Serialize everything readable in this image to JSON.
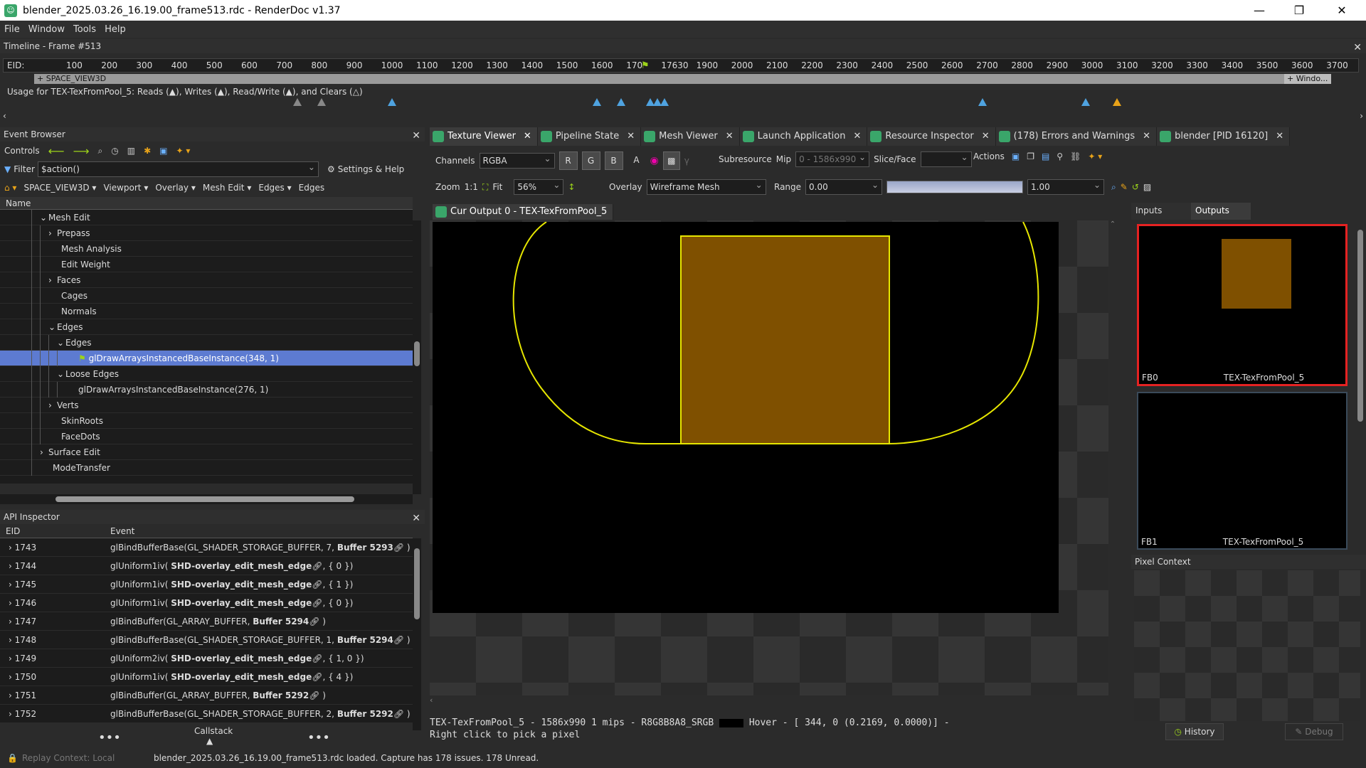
{
  "window": {
    "title": "blender_2025.03.26_16.19.00_frame513.rdc - RenderDoc v1.37"
  },
  "menu": [
    "File",
    "Window",
    "Tools",
    "Help"
  ],
  "timeline": {
    "title": "Timeline - Frame #513",
    "eid_label": "EID:",
    "ticks": [
      "100",
      "200",
      "300",
      "400",
      "500",
      "600",
      "700",
      "800",
      "900",
      "1000",
      "1100",
      "1200",
      "1300",
      "1400",
      "1500",
      "1600",
      "170",
      "17630",
      "1900",
      "2000",
      "2100",
      "2200",
      "2300",
      "2400",
      "2500",
      "2600",
      "2700",
      "2800",
      "2900",
      "3000",
      "3100",
      "3200",
      "3300",
      "3400",
      "3500",
      "3600",
      "3700"
    ],
    "section": "+ SPACE_VIEW3D",
    "section2": "+ Windo...",
    "usage": "Usage for TEX-TexFromPool_5: Reads (▲), Writes (▲), Read/Write (▲), and Clears (△)"
  },
  "event_browser": {
    "title": "Event Browser",
    "controls_label": "Controls",
    "filter_label": "Filter",
    "filter_value": "$action()",
    "settings_label": "Settings & Help",
    "breadcrumbs": [
      "SPACE_VIEW3D",
      "Viewport",
      "Overlay",
      "Mesh Edit",
      "Edges",
      "Edges"
    ],
    "column": "Name",
    "rows": [
      {
        "label": "Mesh Edit",
        "caret": "⌄",
        "indent": 1
      },
      {
        "label": "Prepass",
        "caret": "›",
        "indent": 2
      },
      {
        "label": "Mesh Analysis",
        "caret": "",
        "indent": 2
      },
      {
        "label": "Edit Weight",
        "caret": "",
        "indent": 2
      },
      {
        "label": "Faces",
        "caret": "›",
        "indent": 2
      },
      {
        "label": "Cages",
        "caret": "",
        "indent": 2
      },
      {
        "label": "Normals",
        "caret": "",
        "indent": 2
      },
      {
        "label": "Edges",
        "caret": "⌄",
        "indent": 2
      },
      {
        "label": "Edges",
        "caret": "⌄",
        "indent": 3
      },
      {
        "label": "glDrawArraysInstancedBaseInstance(348, 1)",
        "caret": "",
        "indent": 4,
        "selected": true
      },
      {
        "label": "Loose Edges",
        "caret": "⌄",
        "indent": 3
      },
      {
        "label": "glDrawArraysInstancedBaseInstance(276, 1)",
        "caret": "",
        "indent": 4
      },
      {
        "label": "Verts",
        "caret": "›",
        "indent": 2
      },
      {
        "label": "SkinRoots",
        "caret": "",
        "indent": 2
      },
      {
        "label": "FaceDots",
        "caret": "",
        "indent": 2
      },
      {
        "label": "Surface Edit",
        "caret": "›",
        "indent": 1
      },
      {
        "label": "ModeTransfer",
        "caret": "",
        "indent": 1
      }
    ]
  },
  "api_inspector": {
    "title": "API Inspector",
    "col_eid": "EID",
    "col_event": "Event",
    "rows": [
      {
        "eid": "1743",
        "pre": "glBindBufferBase(GL_SHADER_STORAGE_BUFFER, 7, ",
        "bold": "Buffer 5293",
        "post": " )"
      },
      {
        "eid": "1744",
        "pre": "glUniform1iv( ",
        "bold": "SHD-overlay_edit_mesh_edge",
        "post": ", { 0 })"
      },
      {
        "eid": "1745",
        "pre": "glUniform1iv( ",
        "bold": "SHD-overlay_edit_mesh_edge",
        "post": ", { 1 })"
      },
      {
        "eid": "1746",
        "pre": "glUniform1iv( ",
        "bold": "SHD-overlay_edit_mesh_edge",
        "post": ", { 0 })"
      },
      {
        "eid": "1747",
        "pre": "glBindBuffer(GL_ARRAY_BUFFER, ",
        "bold": "Buffer 5294",
        "post": " )"
      },
      {
        "eid": "1748",
        "pre": "glBindBufferBase(GL_SHADER_STORAGE_BUFFER, 1, ",
        "bold": "Buffer 5294",
        "post": " )"
      },
      {
        "eid": "1749",
        "pre": "glUniform2iv( ",
        "bold": "SHD-overlay_edit_mesh_edge",
        "post": ", { 1, 0 })"
      },
      {
        "eid": "1750",
        "pre": "glUniform1iv( ",
        "bold": "SHD-overlay_edit_mesh_edge",
        "post": ", { 4 })"
      },
      {
        "eid": "1751",
        "pre": "glBindBuffer(GL_ARRAY_BUFFER, ",
        "bold": "Buffer 5292",
        "post": " )"
      },
      {
        "eid": "1752",
        "pre": "glBindBufferBase(GL_SHADER_STORAGE_BUFFER, 2, ",
        "bold": "Buffer 5292",
        "post": " )"
      }
    ],
    "callstack": "Callstack"
  },
  "tabs": [
    {
      "label": "Texture Viewer",
      "active": true
    },
    {
      "label": "Pipeline State"
    },
    {
      "label": "Mesh Viewer"
    },
    {
      "label": "Launch Application"
    },
    {
      "label": "Resource Inspector"
    },
    {
      "label": "(178) Errors and Warnings"
    },
    {
      "label": "blender [PID 16120]"
    }
  ],
  "texture_viewer": {
    "channels_label": "Channels",
    "channels_value": "RGBA",
    "ch_r": "R",
    "ch_g": "G",
    "ch_b": "B",
    "ch_a": "A",
    "subresource_label": "Subresource",
    "mip_label": "Mip",
    "mip_value": "0 - 1586x990",
    "slice_label": "Slice/Face",
    "actions_label": "Actions",
    "zoom_label": "Zoom",
    "zoom_11": "1:1",
    "fit_label": "Fit",
    "zoom_value": "56%",
    "overlay_label": "Overlay",
    "overlay_value": "Wireframe Mesh",
    "range_label": "Range",
    "range_min": "0.00",
    "range_max": "1.00",
    "view_tab": "Cur Output 0 - TEX-TexFromPool_5",
    "status_line1": "TEX-TexFromPool_5 - 1586x990 1 mips - R8G8B8A8_SRGB",
    "status_hover": "Hover - [ 344,    0 (0.2169, 0.0000)] -",
    "status_line2": "Right click to pick a pixel",
    "inputs_tab": "Inputs",
    "outputs_tab": "Outputs",
    "thumbs": [
      {
        "slot": "FB0",
        "name": "TEX-TexFromPool_5"
      },
      {
        "slot": "FB1",
        "name": "TEX-TexFromPool_5"
      }
    ],
    "pixel_context_title": "Pixel Context",
    "history_btn": "History",
    "debug_btn": "Debug"
  },
  "statusbar": {
    "replay": "Replay Context: Local",
    "message": "blender_2025.03.26_16.19.00_frame513.rdc loaded. Capture has 178 issues. 178 Unread."
  },
  "colors": {
    "accent": "#3aa66a",
    "selection": "#5d7bd1",
    "wire": "#e6e600",
    "fill": "#7f5000",
    "highlight_red": "#e52222"
  }
}
